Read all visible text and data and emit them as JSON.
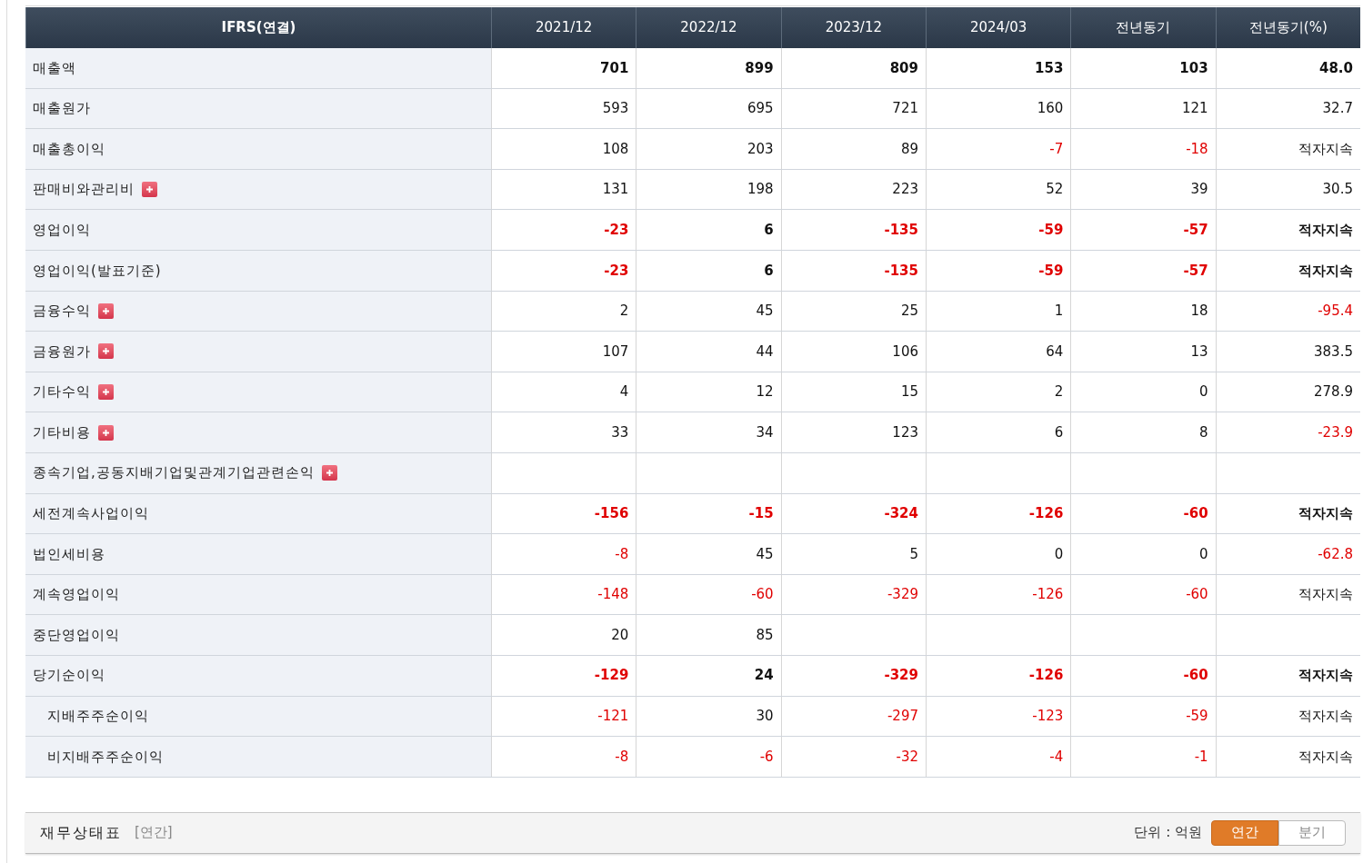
{
  "table": {
    "corner": "IFRS(연결)",
    "columns": [
      "2021/12",
      "2022/12",
      "2023/12",
      "2024/03",
      "전년동기",
      "전년동기(%)"
    ],
    "rows": [
      {
        "label": "매출액",
        "bold": true,
        "expandable": false,
        "cells": [
          {
            "text": "701",
            "red": false
          },
          {
            "text": "899",
            "red": false
          },
          {
            "text": "809",
            "red": false
          },
          {
            "text": "153",
            "red": false
          },
          {
            "text": "103",
            "red": false
          },
          {
            "text": "48.0",
            "red": false
          }
        ]
      },
      {
        "label": "매출원가",
        "bold": false,
        "expandable": false,
        "cells": [
          {
            "text": "593",
            "red": false
          },
          {
            "text": "695",
            "red": false
          },
          {
            "text": "721",
            "red": false
          },
          {
            "text": "160",
            "red": false
          },
          {
            "text": "121",
            "red": false
          },
          {
            "text": "32.7",
            "red": false
          }
        ]
      },
      {
        "label": "매출총이익",
        "bold": false,
        "expandable": false,
        "cells": [
          {
            "text": "108",
            "red": false
          },
          {
            "text": "203",
            "red": false
          },
          {
            "text": "89",
            "red": false
          },
          {
            "text": "-7",
            "red": true
          },
          {
            "text": "-18",
            "red": true
          },
          {
            "text": "적자지속",
            "red": false
          }
        ]
      },
      {
        "label": "판매비와관리비",
        "bold": false,
        "expandable": true,
        "cells": [
          {
            "text": "131",
            "red": false
          },
          {
            "text": "198",
            "red": false
          },
          {
            "text": "223",
            "red": false
          },
          {
            "text": "52",
            "red": false
          },
          {
            "text": "39",
            "red": false
          },
          {
            "text": "30.5",
            "red": false
          }
        ]
      },
      {
        "label": "영업이익",
        "bold": true,
        "expandable": false,
        "cells": [
          {
            "text": "-23",
            "red": true
          },
          {
            "text": "6",
            "red": false
          },
          {
            "text": "-135",
            "red": true
          },
          {
            "text": "-59",
            "red": true
          },
          {
            "text": "-57",
            "red": true
          },
          {
            "text": "적자지속",
            "red": false
          }
        ]
      },
      {
        "label": "영업이익(발표기준)",
        "bold": true,
        "expandable": false,
        "cells": [
          {
            "text": "-23",
            "red": true
          },
          {
            "text": "6",
            "red": false
          },
          {
            "text": "-135",
            "red": true
          },
          {
            "text": "-59",
            "red": true
          },
          {
            "text": "-57",
            "red": true
          },
          {
            "text": "적자지속",
            "red": false
          }
        ]
      },
      {
        "label": "금융수익",
        "bold": false,
        "expandable": true,
        "cells": [
          {
            "text": "2",
            "red": false
          },
          {
            "text": "45",
            "red": false
          },
          {
            "text": "25",
            "red": false
          },
          {
            "text": "1",
            "red": false
          },
          {
            "text": "18",
            "red": false
          },
          {
            "text": "-95.4",
            "red": true
          }
        ]
      },
      {
        "label": "금융원가",
        "bold": false,
        "expandable": true,
        "cells": [
          {
            "text": "107",
            "red": false
          },
          {
            "text": "44",
            "red": false
          },
          {
            "text": "106",
            "red": false
          },
          {
            "text": "64",
            "red": false
          },
          {
            "text": "13",
            "red": false
          },
          {
            "text": "383.5",
            "red": false
          }
        ]
      },
      {
        "label": "기타수익",
        "bold": false,
        "expandable": true,
        "cells": [
          {
            "text": "4",
            "red": false
          },
          {
            "text": "12",
            "red": false
          },
          {
            "text": "15",
            "red": false
          },
          {
            "text": "2",
            "red": false
          },
          {
            "text": "0",
            "red": false
          },
          {
            "text": "278.9",
            "red": false
          }
        ]
      },
      {
        "label": "기타비용",
        "bold": false,
        "expandable": true,
        "cells": [
          {
            "text": "33",
            "red": false
          },
          {
            "text": "34",
            "red": false
          },
          {
            "text": "123",
            "red": false
          },
          {
            "text": "6",
            "red": false
          },
          {
            "text": "8",
            "red": false
          },
          {
            "text": "-23.9",
            "red": true
          }
        ]
      },
      {
        "label": "종속기업,공동지배기업및관계기업관련손익",
        "bold": false,
        "expandable": true,
        "cells": [
          {},
          {},
          {},
          {},
          {},
          {}
        ]
      },
      {
        "label": "세전계속사업이익",
        "bold": true,
        "expandable": false,
        "cells": [
          {
            "text": "-156",
            "red": true
          },
          {
            "text": "-15",
            "red": true
          },
          {
            "text": "-324",
            "red": true
          },
          {
            "text": "-126",
            "red": true
          },
          {
            "text": "-60",
            "red": true
          },
          {
            "text": "적자지속",
            "red": false
          }
        ]
      },
      {
        "label": "법인세비용",
        "bold": false,
        "expandable": false,
        "cells": [
          {
            "text": "-8",
            "red": true
          },
          {
            "text": "45",
            "red": false
          },
          {
            "text": "5",
            "red": false
          },
          {
            "text": "0",
            "red": false
          },
          {
            "text": "0",
            "red": false
          },
          {
            "text": "-62.8",
            "red": true
          }
        ]
      },
      {
        "label": "계속영업이익",
        "bold": false,
        "expandable": false,
        "cells": [
          {
            "text": "-148",
            "red": true
          },
          {
            "text": "-60",
            "red": true
          },
          {
            "text": "-329",
            "red": true
          },
          {
            "text": "-126",
            "red": true
          },
          {
            "text": "-60",
            "red": true
          },
          {
            "text": "적자지속",
            "red": false
          }
        ]
      },
      {
        "label": "중단영업이익",
        "bold": false,
        "expandable": false,
        "cells": [
          {
            "text": "20",
            "red": false
          },
          {
            "text": "85",
            "red": false
          },
          {},
          {},
          {},
          {}
        ]
      },
      {
        "label": "당기순이익",
        "bold": true,
        "expandable": false,
        "cells": [
          {
            "text": "-129",
            "red": true
          },
          {
            "text": "24",
            "red": false
          },
          {
            "text": "-329",
            "red": true
          },
          {
            "text": "-126",
            "red": true
          },
          {
            "text": "-60",
            "red": true
          },
          {
            "text": "적자지속",
            "red": false
          }
        ],
        "children": [
          {
            "label": "지배주주순이익",
            "bold": false,
            "expandable": false,
            "cells": [
              {
                "text": "-121",
                "red": true
              },
              {
                "text": "30",
                "red": false
              },
              {
                "text": "-297",
                "red": true
              },
              {
                "text": "-123",
                "red": true
              },
              {
                "text": "-59",
                "red": true
              },
              {
                "text": "적자지속",
                "red": false
              }
            ]
          },
          {
            "label": "비지배주주순이익",
            "bold": false,
            "expandable": false,
            "cells": [
              {
                "text": "-8",
                "red": true
              },
              {
                "text": "-6",
                "red": true
              },
              {
                "text": "-32",
                "red": true
              },
              {
                "text": "-4",
                "red": true
              },
              {
                "text": "-1",
                "red": true
              },
              {
                "text": "적자지속",
                "red": false
              }
            ]
          }
        ]
      }
    ]
  },
  "footer": {
    "title": "재무상태표",
    "period": "[연간]",
    "unit": "단위 : 억원",
    "toggle": [
      {
        "label": "연간",
        "selected": true
      },
      {
        "label": "분기",
        "selected": false
      }
    ]
  }
}
